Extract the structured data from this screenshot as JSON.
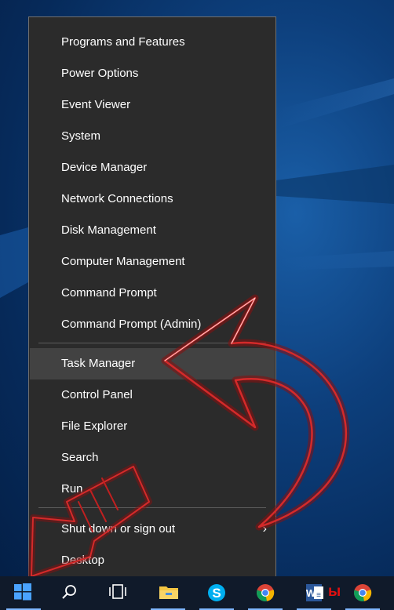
{
  "menu": {
    "groups": [
      [
        "Programs and Features",
        "Power Options",
        "Event Viewer",
        "System",
        "Device Manager",
        "Network Connections",
        "Disk Management",
        "Computer Management",
        "Command Prompt",
        "Command Prompt (Admin)"
      ],
      [
        "Task Manager",
        "Control Panel",
        "File Explorer",
        "Search",
        "Run"
      ],
      [
        "Shut down or sign out",
        "Desktop"
      ]
    ],
    "items": {
      "programs_features": "Programs and Features",
      "power_options": "Power Options",
      "event_viewer": "Event Viewer",
      "system": "System",
      "device_manager": "Device Manager",
      "network_connections": "Network Connections",
      "disk_management": "Disk Management",
      "computer_management": "Computer Management",
      "command_prompt": "Command Prompt",
      "command_prompt_admin": "Command Prompt (Admin)",
      "task_manager": "Task Manager",
      "control_panel": "Control Panel",
      "file_explorer": "File Explorer",
      "search": "Search",
      "run": "Run",
      "shut_down": "Shut down or sign out",
      "desktop": "Desktop"
    },
    "highlighted": "Task Manager",
    "submenu_indicator": "›"
  },
  "taskbar": {
    "icons": [
      "start-windows-icon",
      "search-icon",
      "task-view-icon",
      "file-explorer-icon",
      "skype-icon",
      "chrome-icon",
      "word-icon",
      "chrome-icon"
    ],
    "word_badge": "ы"
  },
  "colors": {
    "menu_bg": "#2b2b2b",
    "menu_highlight": "#424242",
    "annotation_arrow": "#b01818"
  }
}
